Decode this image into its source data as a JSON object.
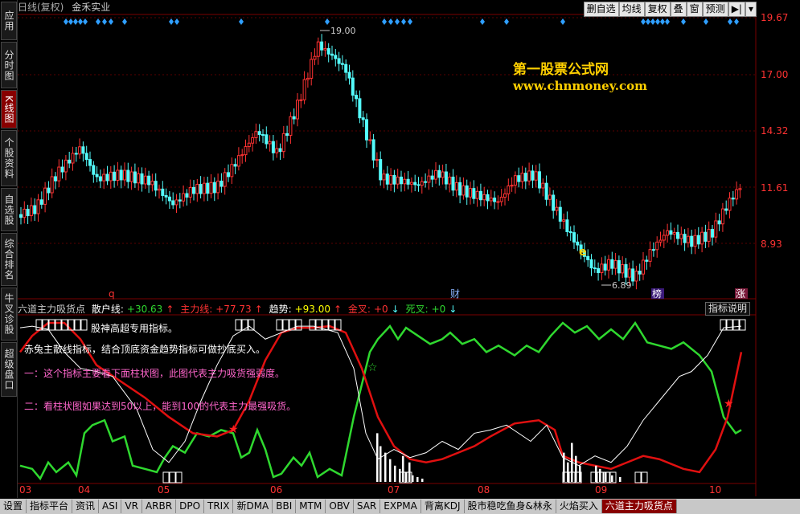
{
  "top": {
    "title": "日线(复权)",
    "stock": "金禾实业",
    "buttons": [
      "删自选",
      "均线",
      "复权",
      "叠",
      "窗",
      "预测"
    ]
  },
  "sidebar": [
    "应用",
    "分时图",
    "K线图",
    "个股资料",
    "自选股",
    "综合排名",
    "牛叉诊股",
    "超级盘口"
  ],
  "watermark": {
    "line1": "第一股票公式网",
    "line2": "www.chnmoney.com"
  },
  "price_axis": [
    "19.67",
    "17.00",
    "14.32",
    "11.61",
    "8.93"
  ],
  "annotations": {
    "high": "19.00",
    "low": "6.89",
    "marks": [
      "q",
      "财",
      "榜",
      "涨"
    ]
  },
  "indicator": {
    "name": "六道主力吸货点",
    "retail_label": "散户线:",
    "retail_value": "+30.63",
    "main_label": "主力线:",
    "main_value": "+77.73",
    "trend_label": "趋势:",
    "trend_value": "+93.00",
    "gold_label": "金叉:",
    "gold_value": "+0",
    "dead_label": "死叉:",
    "dead_value": "+0",
    "help": "指标说明",
    "notes": {
      "n1": "股神高超专用指标。",
      "n2": "赤兔主散线指标，结合顶底资金趋势指标可做抄底买入。",
      "n3": "一：这个指标主要看下面柱状图，此图代表主力吸货强弱度。",
      "n4": "二：看柱状图如果达到50以上，能到100的代表主力最强吸货。"
    }
  },
  "date_axis": [
    "03",
    "04",
    "05",
    "06",
    "07",
    "08",
    "09",
    "10"
  ],
  "bottom_tabs": [
    "设置",
    "指标平台",
    "资讯",
    "ASI",
    "VR",
    "ARBR",
    "DPO",
    "TRIX",
    "新DMA",
    "BBI",
    "MTM",
    "OBV",
    "SAR",
    "EXPMA",
    "背离KDJ",
    "股市稳吃鱼身&林永",
    "火焰买入",
    "六道主力吸货点"
  ],
  "colors": {
    "up": "#ff3232",
    "down": "#54fcfc",
    "green": "#2fd82f",
    "red": "#e01010",
    "white": "#ffffff",
    "grid": "#6a0000"
  }
}
